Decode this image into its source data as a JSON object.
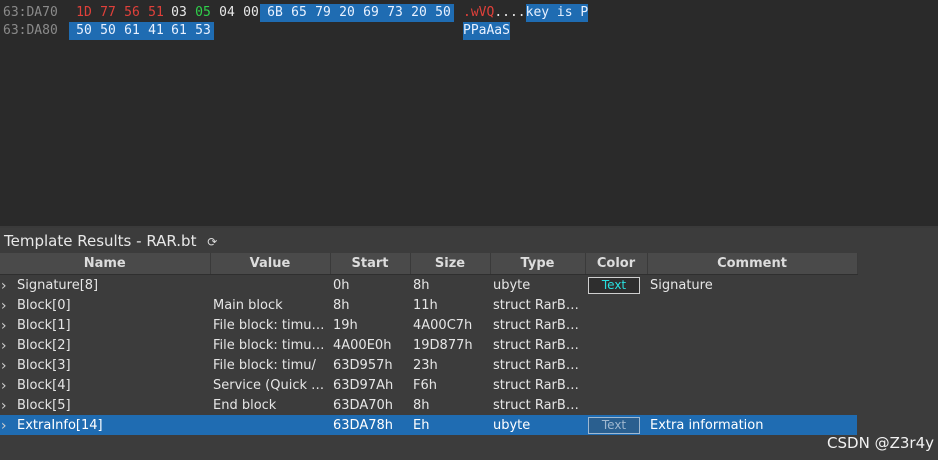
{
  "hex_view": {
    "rows": [
      {
        "address": "63:DA70",
        "bytes": [
          {
            "hex": "1D",
            "style": "red"
          },
          {
            "hex": "77",
            "style": "red"
          },
          {
            "hex": "56",
            "style": "red"
          },
          {
            "hex": "51",
            "style": "red"
          },
          {
            "hex": "03",
            "style": "white"
          },
          {
            "hex": "05",
            "style": "green"
          },
          {
            "hex": "04",
            "style": "white"
          },
          {
            "hex": "00",
            "style": "white"
          },
          {
            "hex": "6B",
            "style": "sel"
          },
          {
            "hex": "65",
            "style": "sel"
          },
          {
            "hex": "79",
            "style": "sel"
          },
          {
            "hex": "20",
            "style": "sel"
          },
          {
            "hex": "69",
            "style": "sel"
          },
          {
            "hex": "73",
            "style": "sel"
          },
          {
            "hex": "20",
            "style": "sel"
          },
          {
            "hex": "50",
            "style": "sel"
          }
        ],
        "ascii": [
          {
            "text": ".wVQ",
            "style": "red"
          },
          {
            "text": "....",
            "style": "white"
          },
          {
            "text": "key is P",
            "style": "sel"
          }
        ]
      },
      {
        "address": "63:DA80",
        "bytes": [
          {
            "hex": "50",
            "style": "sel"
          },
          {
            "hex": "50",
            "style": "sel"
          },
          {
            "hex": "61",
            "style": "sel"
          },
          {
            "hex": "41",
            "style": "sel"
          },
          {
            "hex": "61",
            "style": "sel"
          },
          {
            "hex": "53",
            "style": "sel"
          }
        ],
        "ascii": [
          {
            "text": "PPaAaS",
            "style": "sel"
          }
        ]
      }
    ]
  },
  "template_results": {
    "title": "Template Results - RAR.bt",
    "refresh_icon": "⟳",
    "columns": [
      "Name",
      "Value",
      "Start",
      "Size",
      "Type",
      "Color",
      "Comment"
    ],
    "rows": [
      {
        "name": "Signature[8]",
        "value": "",
        "start": "0h",
        "size": "8h",
        "type": "ubyte",
        "color": "Text",
        "comment": "Signature",
        "selected": false
      },
      {
        "name": "Block[0]",
        "value": "Main block",
        "start": "8h",
        "size": "11h",
        "type": "struct RarBlo...",
        "color": "",
        "comment": "",
        "selected": false
      },
      {
        "name": "Block[1]",
        "value": "File block: timu/fi...",
        "start": "19h",
        "size": "4A00C7h",
        "type": "struct RarBlo...",
        "color": "",
        "comment": "",
        "selected": false
      },
      {
        "name": "Block[2]",
        "value": "File block: timu/s...",
        "start": "4A00E0h",
        "size": "19D877h",
        "type": "struct RarBlo...",
        "color": "",
        "comment": "",
        "selected": false
      },
      {
        "name": "Block[3]",
        "value": "File block: timu/",
        "start": "63D957h",
        "size": "23h",
        "type": "struct RarBlo...",
        "color": "",
        "comment": "",
        "selected": false
      },
      {
        "name": "Block[4]",
        "value": "Service (Quick o...",
        "start": "63D97Ah",
        "size": "F6h",
        "type": "struct RarBlo...",
        "color": "",
        "comment": "",
        "selected": false
      },
      {
        "name": "Block[5]",
        "value": "End block",
        "start": "63DA70h",
        "size": "8h",
        "type": "struct RarBlo...",
        "color": "",
        "comment": "",
        "selected": false
      },
      {
        "name": "ExtraInfo[14]",
        "value": "",
        "start": "63DA78h",
        "size": "Eh",
        "type": "ubyte",
        "color": "Text",
        "comment": "Extra information",
        "selected": true
      }
    ]
  },
  "watermark": "CSDN @Z3r4y",
  "colors": {
    "selection": "#1f6cb2",
    "modified_red": "#e0403a",
    "green": "#2fd04a",
    "color_chip_text": "#29e0e0"
  }
}
